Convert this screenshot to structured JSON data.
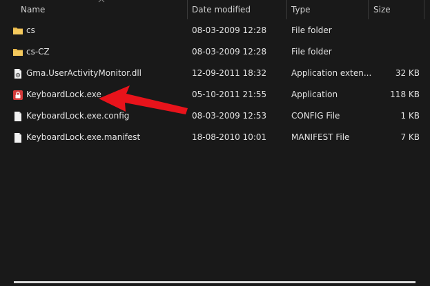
{
  "columns": {
    "name": "Name",
    "date": "Date modified",
    "type": "Type",
    "size": "Size"
  },
  "files": [
    {
      "name": "cs",
      "date": "08-03-2009 12:28",
      "type": "File folder",
      "size": "",
      "icon": "folder-icon"
    },
    {
      "name": "cs-CZ",
      "date": "08-03-2009 12:28",
      "type": "File folder",
      "size": "",
      "icon": "folder-icon"
    },
    {
      "name": "Gma.UserActivityMonitor.dll",
      "date": "12-09-2011 18:32",
      "type": "Application exten...",
      "size": "32 KB",
      "icon": "dll-file-icon"
    },
    {
      "name": "KeyboardLock.exe",
      "date": "05-10-2011 21:55",
      "type": "Application",
      "size": "118 KB",
      "icon": "lock-app-icon"
    },
    {
      "name": "KeyboardLock.exe.config",
      "date": "08-03-2009 12:53",
      "type": "CONFIG File",
      "size": "1 KB",
      "icon": "document-icon"
    },
    {
      "name": "KeyboardLock.exe.manifest",
      "date": "18-08-2010 10:01",
      "type": "MANIFEST File",
      "size": "7 KB",
      "icon": "document-icon"
    }
  ],
  "colors": {
    "background": "#191919",
    "folder": "#e8b84a",
    "annotation_arrow": "#e8131b",
    "app_icon": "#d43a3a"
  }
}
